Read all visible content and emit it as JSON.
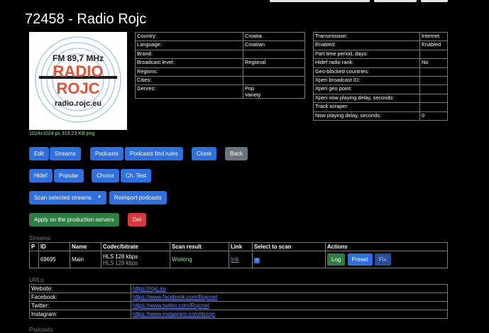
{
  "header": {
    "title": "72458 - Radio Rojc"
  },
  "logo": {
    "frequency": "FM 89,7 MHz",
    "line1": "RADIO",
    "line2": "ROJC",
    "site": "radio.rojc.eu",
    "meta": "1024x1024 px 319.23 KB png"
  },
  "country_table": [
    {
      "label": "Country:",
      "value": "Croatia"
    },
    {
      "label": "Language:",
      "value": "Croatian"
    },
    {
      "label": "Brand:",
      "value": ""
    },
    {
      "label": "Broadcast level:",
      "value": "Regional"
    },
    {
      "label": "Regions:",
      "value": ""
    },
    {
      "label": "Cities:",
      "value": ""
    },
    {
      "label": "Genres:",
      "value": "Pop",
      "value2": "Variety"
    }
  ],
  "tx_table": [
    {
      "label": "Transmission:",
      "value": "Internet"
    },
    {
      "label": "Enabled:",
      "value": "Enabled"
    },
    {
      "label": "Part time period, days:",
      "value": ""
    },
    {
      "label": "Hidef radio rank:",
      "value": "No"
    },
    {
      "label": "Geo-blocked countries:",
      "value": ""
    },
    {
      "label": "Xperi broadcast ID:",
      "value": ""
    },
    {
      "label": "Xperi geo point:",
      "value": ""
    },
    {
      "label": "Xperi now playing delay, seconds:",
      "value": ""
    },
    {
      "label": "Track scraper:",
      "value": ""
    },
    {
      "label": "Now playing delay, seconds:",
      "value": "0"
    }
  ],
  "buttons": {
    "edit": "Edit",
    "streams": "Streams",
    "podcasts": "Podcasts",
    "podcasts_find_rules": "Podcasts find rules",
    "clone": "Clone",
    "back": "Back",
    "hidef": "Hidef",
    "popular": "Popular",
    "choice": "Choice",
    "ch_test": "Ch. Test",
    "scan_selected": "Scan selected streams",
    "reimport": "Reimport podcasts",
    "apply_production": "Apply on the production servers",
    "del": "Del"
  },
  "streams": {
    "label": "Streams:",
    "headers": [
      "P",
      "ID",
      "Name",
      "Codec/bitrate",
      "Scan result",
      "Link",
      "Select to scan",
      "Actions"
    ],
    "row": {
      "p": "",
      "id": "69695",
      "name": "Main",
      "codec": "HLS 128 kbps",
      "codec2": "HLS 128 kbps",
      "scan_result": "Working",
      "link": "link",
      "actions": [
        "Log",
        "Preset",
        "Fix"
      ]
    }
  },
  "urls": {
    "label": "URLs:",
    "rows": [
      {
        "label": "Website:",
        "value": "https://rojc.eu"
      },
      {
        "label": "Facebook:",
        "value": "https://www.facebook.com/Rojcnet"
      },
      {
        "label": "Twitter:",
        "value": "https://www.twitter.com/Rojcnet"
      },
      {
        "label": "Instagram:",
        "value": "https://www.instagram.com/dcrojc"
      }
    ]
  },
  "podcasts_label": "Podcasts:"
}
